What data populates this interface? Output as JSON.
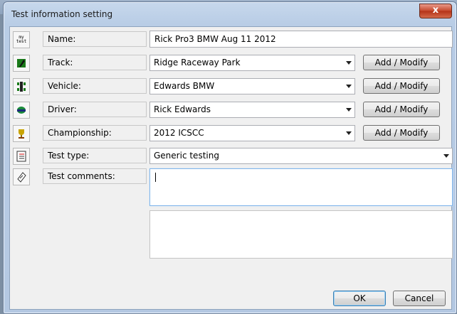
{
  "window": {
    "title": "Test information setting",
    "close_glyph": "x"
  },
  "icons": {
    "name": "my-test-icon",
    "track": "track-flag-icon",
    "vehicle": "vehicle-icon",
    "driver": "driver-helmet-icon",
    "championship": "trophy-icon",
    "test_type": "checklist-icon",
    "test_comments": "notepad-icon"
  },
  "name_icon_text": "my test",
  "form": {
    "name": {
      "label": "Name:",
      "value": "Rick Pro3 BMW Aug 11 2012"
    },
    "track": {
      "label": "Track:",
      "value": "Ridge Raceway Park",
      "button": "Add / Modify"
    },
    "vehicle": {
      "label": "Vehicle:",
      "value": "Edwards BMW",
      "button": "Add / Modify"
    },
    "driver": {
      "label": "Driver:",
      "value": "Rick Edwards",
      "button": "Add / Modify"
    },
    "championship": {
      "label": "Championship:",
      "value": "2012 ICSCC",
      "button": "Add / Modify"
    },
    "test_type": {
      "label": "Test type:",
      "value": "Generic testing"
    },
    "test_comments": {
      "label": "Test comments:",
      "value": ""
    }
  },
  "buttons": {
    "ok": "OK",
    "cancel": "Cancel"
  },
  "colors": {
    "close_button": "#c5472b",
    "focus_border": "#7eb4ea"
  }
}
